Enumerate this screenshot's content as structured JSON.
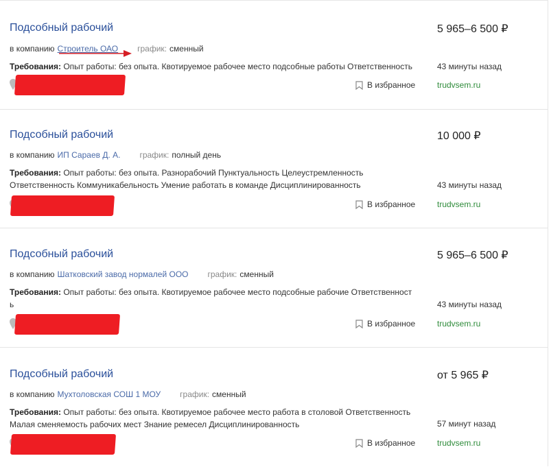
{
  "jobs": [
    {
      "title": "Подсобный рабочий",
      "salary": "5 965–6 500 ₽",
      "company_prefix": "в компанию",
      "company": "Строитель ОАО",
      "schedule_label": "график:",
      "schedule": "сменный",
      "req_label": "Требования:",
      "req_text": "Опыт работы: без опыта. Квотируемое рабочее место подсобные работы Ответственность",
      "time": "43 минуты назад",
      "favorite": "В избранное",
      "source": "trudvsem.ru"
    },
    {
      "title": "Подсобный рабочий",
      "salary": "10 000 ₽",
      "company_prefix": "в компанию",
      "company": "ИП Сараев Д. А.",
      "schedule_label": "график:",
      "schedule": "полный день",
      "req_label": "Требования:",
      "req_text": "Опыт работы: без опыта. Разнорабочий Пунктуальность Целеустремленность Ответственность Коммуникабельность Умение работать в команде Дисциплинированность",
      "time": "43 минуты назад",
      "favorite": "В избранное",
      "source": "trudvsem.ru"
    },
    {
      "title": "Подсобный рабочий",
      "salary": "5 965–6 500 ₽",
      "company_prefix": "в компанию",
      "company": "Шатковский завод нормалей ООО",
      "schedule_label": "график:",
      "schedule": "сменный",
      "req_label": "Требования:",
      "req_text": "Опыт работы: без опыта. Квотируемое рабочее место подсобные рабочие Ответственность",
      "time": "43 минуты назад",
      "favorite": "В избранное",
      "source": "trudvsem.ru"
    },
    {
      "title": "Подсобный рабочий",
      "salary": "от 5 965 ₽",
      "company_prefix": "в компанию",
      "company": "Мухтоловская СОШ 1 МОУ",
      "schedule_label": "график:",
      "schedule": "сменный",
      "req_label": "Требования:",
      "req_text": "Опыт работы: без опыта. Квотируемое рабочее место работа в столовой Ответственность Малая сменяемость рабочих мест Знание ремесел Дисциплинированность",
      "time": "57 минут назад",
      "favorite": "В избранное",
      "source": "trudvsem.ru"
    }
  ],
  "colors": {
    "title": "#2a4f9a",
    "source": "#2e8b3a",
    "redaction": "#ee1d23"
  },
  "icons": {
    "location": "map-pin-icon",
    "favorite": "bookmark-icon"
  }
}
